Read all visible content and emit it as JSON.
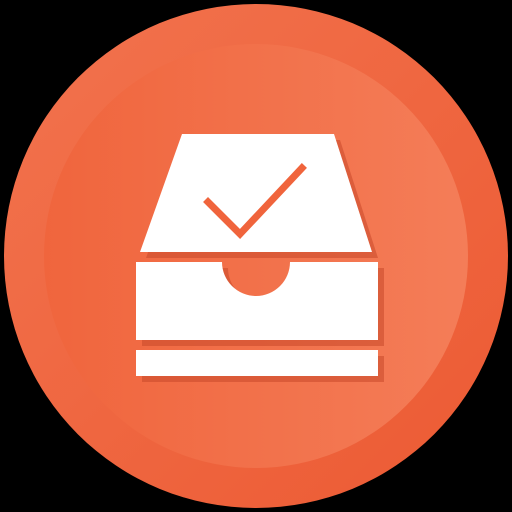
{
  "icon": {
    "name": "inbox-tray-checkmark-icon",
    "colors": {
      "background": "#000000",
      "circle_outer": "#F0643C",
      "circle_inner": "#F27A55",
      "glyph": "#FFFFFF",
      "shadow": "#C9492A"
    }
  }
}
